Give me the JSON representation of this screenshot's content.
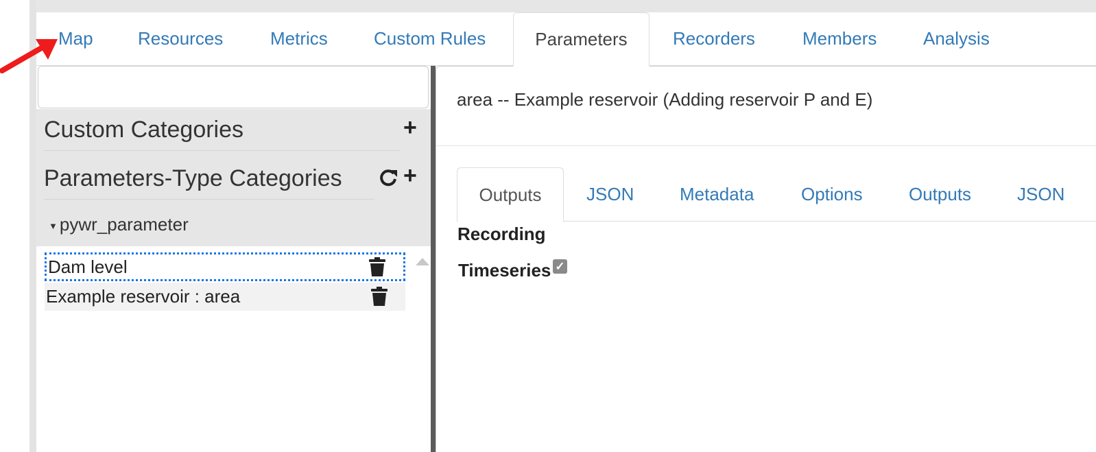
{
  "nav": {
    "tabs": [
      {
        "label": "Map"
      },
      {
        "label": "Resources"
      },
      {
        "label": "Metrics"
      },
      {
        "label": "Custom Rules"
      },
      {
        "label": "Parameters",
        "active": true
      },
      {
        "label": "Recorders"
      },
      {
        "label": "Members"
      },
      {
        "label": "Analysis"
      }
    ]
  },
  "left": {
    "search_value": "",
    "custom_categories": "Custom Categories",
    "parameter_type_categories": "Parameters-Type Categories",
    "tree_item": "pywr_parameter",
    "list": [
      {
        "label": "Dam level"
      },
      {
        "label": "Example reservoir : area"
      }
    ]
  },
  "right": {
    "title": "area -- Example reservoir (Adding reservoir P and E)",
    "sub_tabs": [
      {
        "label": "Outputs",
        "active": true
      },
      {
        "label": "JSON"
      },
      {
        "label": "Metadata"
      },
      {
        "label": "Options"
      },
      {
        "label": "Outputs"
      },
      {
        "label": "JSON"
      }
    ],
    "recording_label": "Recording",
    "timeseries_label": "Timeseries",
    "timeseries_checked": true
  },
  "colors": {
    "link": "#337ab7",
    "arrow": "#ee1c1c",
    "focus": "#1a73e8"
  },
  "icons": {
    "add": "plus-icon",
    "refresh": "refresh-icon",
    "delete": "trash-icon",
    "expand": "caret-down-icon",
    "scroll": "scroll-up-icon",
    "annotation": "red-arrow-icon"
  }
}
